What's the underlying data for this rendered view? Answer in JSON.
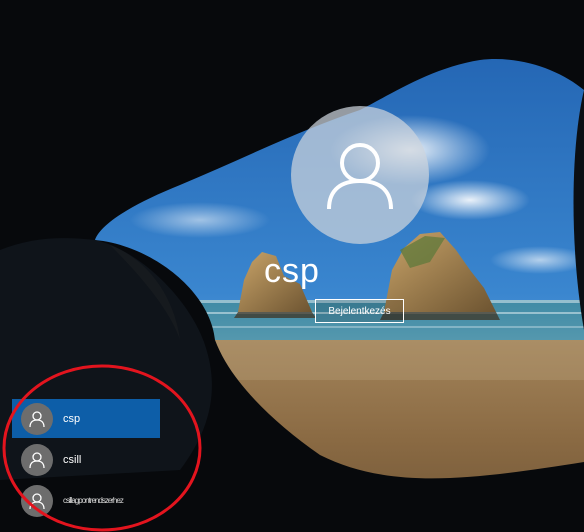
{
  "login": {
    "large_avatar_icon": "person-icon",
    "username": "csp",
    "signin_label": "Bejelentkezés"
  },
  "user_list": [
    {
      "name": "csp",
      "selected": true,
      "icon": "person-icon"
    },
    {
      "name": "csill",
      "selected": false,
      "icon": "person-icon"
    },
    {
      "name": "csillagpontrendszerhez",
      "selected": false,
      "icon": "person-icon"
    }
  ],
  "colors": {
    "selected_item": "#0d5ea8",
    "highlight_ellipse": "#e3141e",
    "avatar_bg": "#6d6d6d"
  }
}
